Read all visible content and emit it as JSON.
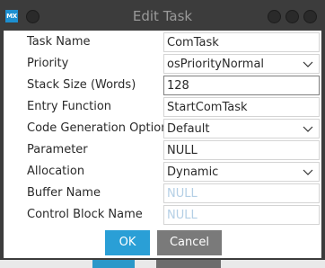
{
  "window": {
    "title": "Edit Task",
    "app_icon": "MX"
  },
  "form": {
    "rows": [
      {
        "label": "Task Name",
        "value": "ComTask",
        "type": "text"
      },
      {
        "label": "Priority",
        "value": "osPriorityNormal",
        "type": "select"
      },
      {
        "label": "Stack Size (Words)",
        "value": "128",
        "type": "text"
      },
      {
        "label": "Entry Function",
        "value": "StartComTask",
        "type": "text"
      },
      {
        "label": "Code Generation Option",
        "value": "Default",
        "type": "select"
      },
      {
        "label": "Parameter",
        "value": "NULL",
        "type": "text"
      },
      {
        "label": "Allocation",
        "value": "Dynamic",
        "type": "select"
      },
      {
        "label": "Buffer Name",
        "placeholder": "NULL",
        "type": "text"
      },
      {
        "label": "Control Block Name",
        "placeholder": "NULL",
        "type": "text"
      }
    ]
  },
  "buttons": {
    "ok": "OK",
    "cancel": "Cancel"
  },
  "colors": {
    "accent": "#2a9fd6",
    "cancel": "#7a7a7a",
    "titlebar": "#3c3c3c"
  }
}
